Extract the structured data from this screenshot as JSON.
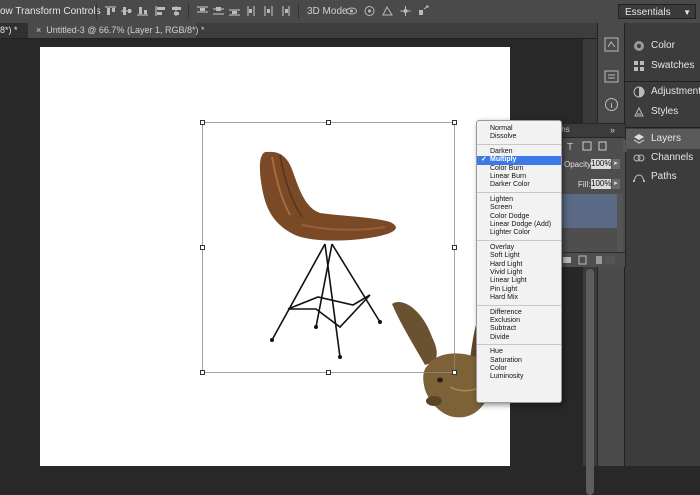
{
  "options_bar": {
    "show_transform_controls": "ow Transform Controls",
    "mode_3d_label": "3D Mode:",
    "workspace": "Essentials"
  },
  "tabs": [
    {
      "label": "8*) *"
    },
    {
      "label": "Untitled-3 @ 66.7% (Layer 1, RGB/8*) *"
    }
  ],
  "panels": {
    "items": [
      {
        "label": "Color",
        "icon": "color-icon"
      },
      {
        "label": "Swatches",
        "icon": "swatches-icon"
      },
      {
        "label": "Adjustments",
        "icon": "adjustments-icon"
      },
      {
        "label": "Styles",
        "icon": "styles-icon"
      },
      {
        "label": "Layers",
        "icon": "layers-icon"
      },
      {
        "label": "Channels",
        "icon": "channels-icon"
      },
      {
        "label": "Paths",
        "icon": "paths-icon"
      }
    ]
  },
  "layers_panel": {
    "header": "ths",
    "opacity_label": "Opacity:",
    "opacity_value": "100%",
    "fill_label": "Fill:",
    "fill_value": "100%"
  },
  "blend_menu": {
    "selected": "Multiply",
    "groups": [
      [
        "Normal",
        "Dissolve"
      ],
      [
        "Darken",
        "Multiply",
        "Color Burn",
        "Linear Burn",
        "Darker Color"
      ],
      [
        "Lighten",
        "Screen",
        "Color Dodge",
        "Linear Dodge (Add)",
        "Lighter Color"
      ],
      [
        "Overlay",
        "Soft Light",
        "Hard Light",
        "Vivid Light",
        "Linear Light",
        "Pin Light",
        "Hard Mix"
      ],
      [
        "Difference",
        "Exclusion",
        "Subtract",
        "Divide"
      ],
      [
        "Hue",
        "Saturation",
        "Color",
        "Luminosity"
      ]
    ]
  },
  "colors": {
    "menu_highlight": "#3e7ae6",
    "selected_layer": "#5a6a86"
  }
}
